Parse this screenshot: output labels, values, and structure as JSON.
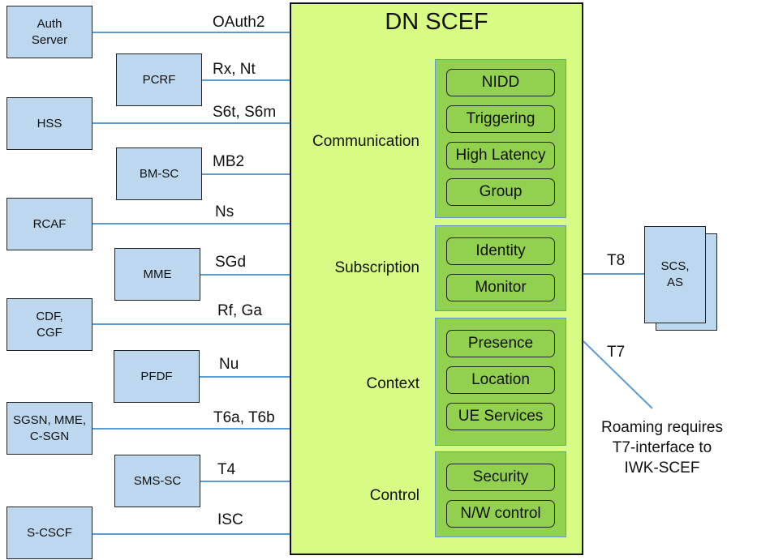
{
  "scef": {
    "title": "DN SCEF",
    "groups": [
      {
        "label": "Communication",
        "capabilities": [
          "NIDD",
          "Triggering",
          "High Latency",
          "Group"
        ]
      },
      {
        "label": "Subscription",
        "capabilities": [
          "Identity",
          "Monitor"
        ]
      },
      {
        "label": "Context",
        "capabilities": [
          "Presence",
          "Location",
          "UE Services"
        ]
      },
      {
        "label": "Control",
        "capabilities": [
          "Security",
          "N/W control"
        ]
      }
    ]
  },
  "southbound": [
    {
      "node": "Auth\nServer",
      "interface": "OAuth2"
    },
    {
      "node": "PCRF",
      "interface": "Rx, Nt"
    },
    {
      "node": "HSS",
      "interface": "S6t, S6m"
    },
    {
      "node": "BM-SC",
      "interface": "MB2"
    },
    {
      "node": "RCAF",
      "interface": "Ns"
    },
    {
      "node": "MME",
      "interface": "SGd"
    },
    {
      "node": "CDF,\nCGF",
      "interface": "Rf, Ga"
    },
    {
      "node": "PFDF",
      "interface": "Nu"
    },
    {
      "node": "SGSN, MME,\nC-SGN",
      "interface": "T6a, T6b"
    },
    {
      "node": "SMS-SC",
      "interface": "T4"
    },
    {
      "node": "S-CSCF",
      "interface": "ISC"
    }
  ],
  "northbound": {
    "node": "SCS,\nAS",
    "interface": "T8",
    "roaming_interface": "T7",
    "roaming_note": "Roaming requires\nT7-interface to\nIWK-SCEF"
  },
  "colors": {
    "scef_fill": "#d8fb86",
    "group_fill": "#92d050",
    "node_fill": "#bdd7ee",
    "link": "#5b9bd5"
  }
}
